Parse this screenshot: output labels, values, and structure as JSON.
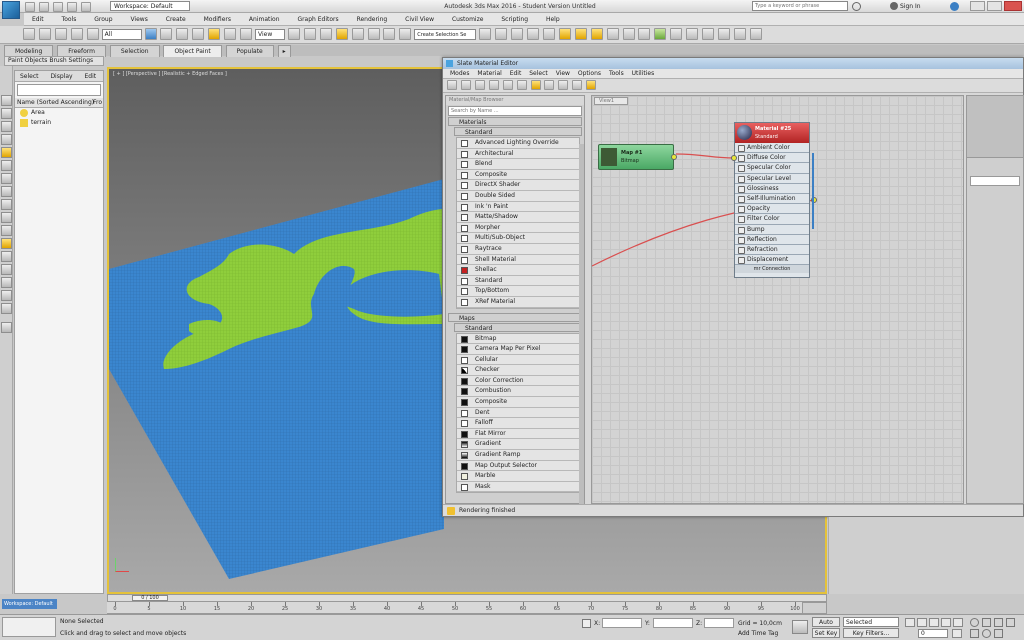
{
  "titlebar": {
    "app_title": "Autodesk 3ds Max 2016 - Student Version    Untitled",
    "workspace": "Workspace: Default",
    "search_placeholder": "Type a keyword or phrase",
    "sign_in": "Sign In"
  },
  "menubar": [
    "Edit",
    "Tools",
    "Group",
    "Views",
    "Create",
    "Modifiers",
    "Animation",
    "Graph Editors",
    "Rendering",
    "Civil View",
    "Customize",
    "Scripting",
    "Help"
  ],
  "main_toolbar": {
    "filter_value": "All",
    "view_value": "View",
    "selection_set": "Create Selection Se"
  },
  "ribbon_tabs": [
    "Modeling",
    "Freeform",
    "Selection",
    "Object Paint",
    "Populate"
  ],
  "ribbon_active": "Object Paint",
  "ribbon_sub": "Paint Objects  Brush Settings",
  "scene_explorer": {
    "tabs": [
      "Select",
      "Display",
      "Edit"
    ],
    "column_header": "Name (Sorted Ascending)",
    "column_header_2": "Fro",
    "items": [
      "Area",
      "terrain"
    ]
  },
  "viewport": {
    "label": "[ + ] [Perspective ] [Realistic + Edged Faces ]",
    "colors": {
      "blue": "#3a86cf",
      "green": "#8fce3c",
      "bg_top": "#5e5e5e",
      "bg_bottom": "#a9a9a9",
      "frame": "#e4c23a"
    },
    "time_slider": "0 / 100"
  },
  "sme": {
    "title": "Slate Material Editor",
    "menus": [
      "Modes",
      "Material",
      "Edit",
      "Select",
      "View",
      "Options",
      "Tools",
      "Utilities"
    ],
    "browser_header": "Material/Map Browser",
    "search_placeholder": "Search by Name ...",
    "materials_section": "Materials",
    "standard_section": "Standard",
    "materials": [
      "Advanced Lighting Override",
      "Architectural",
      "Blend",
      "Composite",
      "DirectX Shader",
      "Double Sided",
      "Ink 'n Paint",
      "Matte/Shadow",
      "Morpher",
      "Multi/Sub-Object",
      "Raytrace",
      "Shell Material",
      "Shellac",
      "Standard",
      "Top/Bottom",
      "XRef Material"
    ],
    "maps_section": "Maps",
    "maps_standard": "Standard",
    "maps": [
      "Bitmap",
      "Camera Map Per Pixel",
      "Cellular",
      "Checker",
      "Color Correction",
      "Combustion",
      "Composite",
      "Dent",
      "Falloff",
      "Flat Mirror",
      "Gradient",
      "Gradient Ramp",
      "Map Output Selector",
      "Marble",
      "Mask"
    ],
    "view_tab": "View1",
    "map_node": {
      "title": "Map #1",
      "subtitle": "Bitmap"
    },
    "material_node": {
      "title": "Material #25",
      "subtitle": "Standard",
      "slots": [
        "Ambient Color",
        "Diffuse Color",
        "Specular Color",
        "Specular Level",
        "Glossiness",
        "Self-Illumination",
        "Opacity",
        "Filter Color",
        "Bump",
        "Reflection",
        "Refraction",
        "Displacement",
        "mr Connection"
      ]
    },
    "status": "Rendering finished"
  },
  "statusbar": {
    "workspace": "Workspace: Default",
    "selection": "None Selected",
    "prompt": "Click and drag to select and move objects",
    "grid": "Grid = 10,0cm",
    "add_time_tag": "Add Time Tag",
    "auto_key": "Auto Key",
    "set_key": "Set Key",
    "selected_dropdown": "Selected",
    "key_filters": "Key Filters...",
    "frame": "0",
    "x_label": "X:",
    "y_label": "Y:",
    "z_label": "Z:"
  },
  "timeline_ticks": [
    "0",
    "5",
    "10",
    "15",
    "20",
    "25",
    "30",
    "35",
    "40",
    "45",
    "50",
    "55",
    "60",
    "65",
    "70",
    "75",
    "80",
    "85",
    "90",
    "95",
    "100"
  ]
}
